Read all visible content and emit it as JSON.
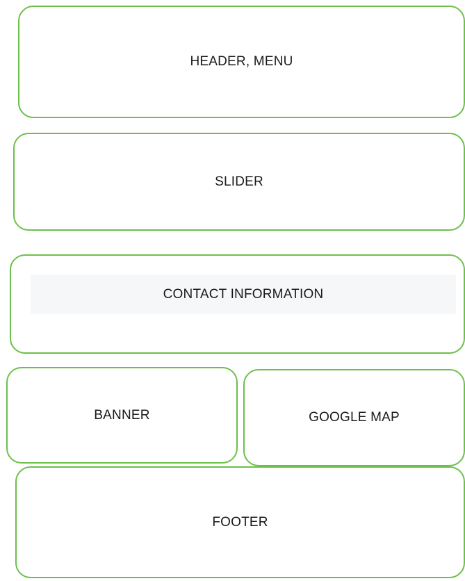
{
  "blocks": {
    "header": "HEADER, MENU",
    "slider": "SLIDER",
    "contact": "CONTACT INFORMATION",
    "banner": "BANNER",
    "map": "GOOGLE MAP",
    "footer": "FOOTER"
  },
  "colors": {
    "border": "#6cc04a",
    "band": "#f6f7f9",
    "text": "#1a1a1a"
  }
}
